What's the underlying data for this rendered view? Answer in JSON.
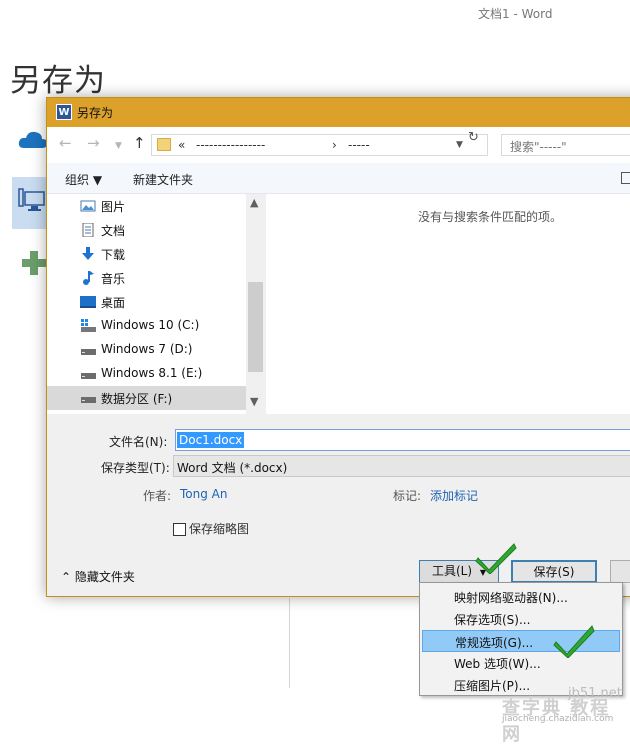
{
  "backstage": {
    "window_title": "文档1 - Word",
    "heading": "另存为"
  },
  "dialog": {
    "title": "另存为",
    "app_icon_letter": "W",
    "address": {
      "chevron": "«",
      "segment1": "----------------",
      "separator": "›",
      "segment2": "-----"
    },
    "search_placeholder": "搜索\"-----\"",
    "toolbar": {
      "organize": "组织 ▼",
      "new_folder": "新建文件夹"
    },
    "nav_items": [
      {
        "label": "图片",
        "icon": "pictures-icon"
      },
      {
        "label": "文档",
        "icon": "documents-icon"
      },
      {
        "label": "下载",
        "icon": "downloads-icon"
      },
      {
        "label": "音乐",
        "icon": "music-icon"
      },
      {
        "label": "桌面",
        "icon": "desktop-icon"
      },
      {
        "label": "Windows 10 (C:)",
        "icon": "windows-drive-icon"
      },
      {
        "label": "Windows 7 (D:)",
        "icon": "drive-icon"
      },
      {
        "label": "Windows 8.1 (E:)",
        "icon": "drive-icon"
      },
      {
        "label": "数据分区 (F:)",
        "icon": "drive-icon",
        "selected": true
      }
    ],
    "empty_message": "没有与搜索条件匹配的项。",
    "filename_label": "文件名(N):",
    "filename_value": "Doc1.docx",
    "filetype_label": "保存类型(T):",
    "filetype_value": "Word 文档 (*.docx)",
    "author_label": "作者:",
    "author_value": "Tong An",
    "tags_label": "标记:",
    "tags_value": "添加标记",
    "thumbnail_label": "保存缩略图",
    "hide_folders": "隐藏文件夹",
    "tools_button": "工具(L)",
    "save_button": "保存(S)"
  },
  "tools_menu": [
    {
      "label": "映射网络驱动器(N)..."
    },
    {
      "label": "保存选项(S)..."
    },
    {
      "label": "常规选项(G)...",
      "highlighted": true
    },
    {
      "label": "Web 选项(W)..."
    },
    {
      "label": "压缩图片(P)..."
    }
  ],
  "watermark": {
    "brand": "查字典 教程网",
    "domain": "jiaocheng.chazidian.com",
    "site": "jb51.net"
  },
  "colors": {
    "titlebar": "#dba12a",
    "accent_blue": "#3c7fb1",
    "menu_highlight": "#91c9f7",
    "checkmark_green": "#2fa832"
  }
}
